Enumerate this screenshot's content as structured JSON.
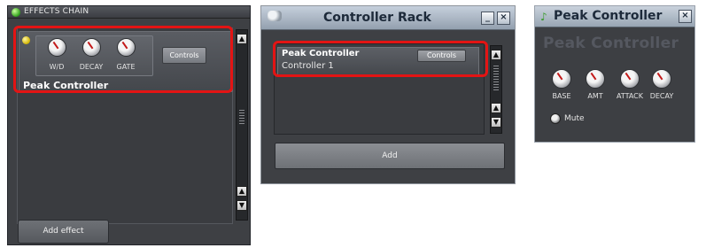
{
  "effects_chain": {
    "title": "EFFECTS CHAIN",
    "effect": {
      "name": "Peak Controller",
      "knobs": [
        "W/D",
        "DECAY",
        "GATE"
      ],
      "controls_label": "Controls"
    },
    "add_effect_label": "Add effect"
  },
  "controller_rack": {
    "title": "Controller Rack",
    "controller": {
      "name": "Peak Controller",
      "instance": "Controller 1",
      "controls_label": "Controls"
    },
    "add_label": "Add"
  },
  "peak_controller": {
    "title": "Peak Controller",
    "header_text": "Peak Controller",
    "knobs": [
      "BASE",
      "AMT",
      "ATTACK",
      "DECAY"
    ],
    "mute_label": "Mute"
  },
  "colors": {
    "highlight": "#e31414",
    "panel": "#3e4044",
    "title_gradient_top": "#c6d0dc"
  }
}
